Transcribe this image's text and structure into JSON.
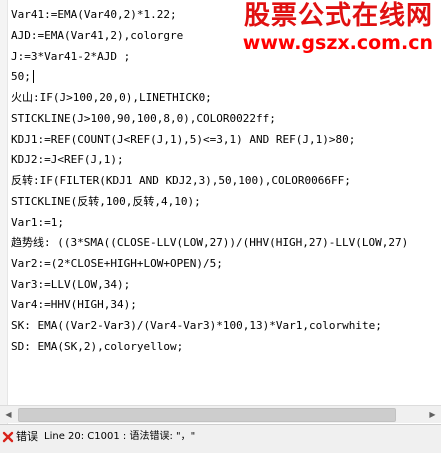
{
  "editor": {
    "lines": [
      "Var41:=EMA(Var40,2)*1.22;",
      "AJD:=EMA(Var41,2),colorgre",
      "J:=3*Var41-2*AJD ;",
      "50;",
      "火山:IF(J>100,20,0),LINETHICK0;",
      "STICKLINE(J>100,90,100,8,0),COLOR0022ff;",
      "KDJ1:=REF(COUNT(J<REF(J,1),5)<=3,1) AND REF(J,1)>80;",
      "KDJ2:=J<REF(J,1);",
      "反转:IF(FILTER(KDJ1 AND KDJ2,3),50,100),COLOR0066FF;",
      "STICKLINE(反转,100,反转,4,10);",
      "Var1:=1;",
      "趋势线: ((3*SMA((CLOSE-LLV(LOW,27))/(HHV(HIGH,27)-LLV(LOW,27)",
      "Var2:=(2*CLOSE+HIGH+LOW+OPEN)/5;",
      "Var3:=LLV(LOW,34);",
      "Var4:=HHV(HIGH,34);",
      "SK: EMA((Var2-Var3)/(Var4-Var3)*100,13)*Var1,colorwhite;",
      "SD: EMA(SK,2),coloryellow;"
    ]
  },
  "watermark": {
    "title": "股票公式在线网",
    "url": "www.gszx.com.cn"
  },
  "status": {
    "label": "错误",
    "message": "Line 20: C1001 : 语法错误: \"，\""
  },
  "colors": {
    "watermark": "#e01010",
    "error_icon": "#d8231b",
    "status_bg": "#f0f0f0"
  },
  "icons": {
    "error": "error-x-icon",
    "scroll_left": "scroll-left-arrow-icon",
    "scroll_right": "scroll-right-arrow-icon"
  }
}
